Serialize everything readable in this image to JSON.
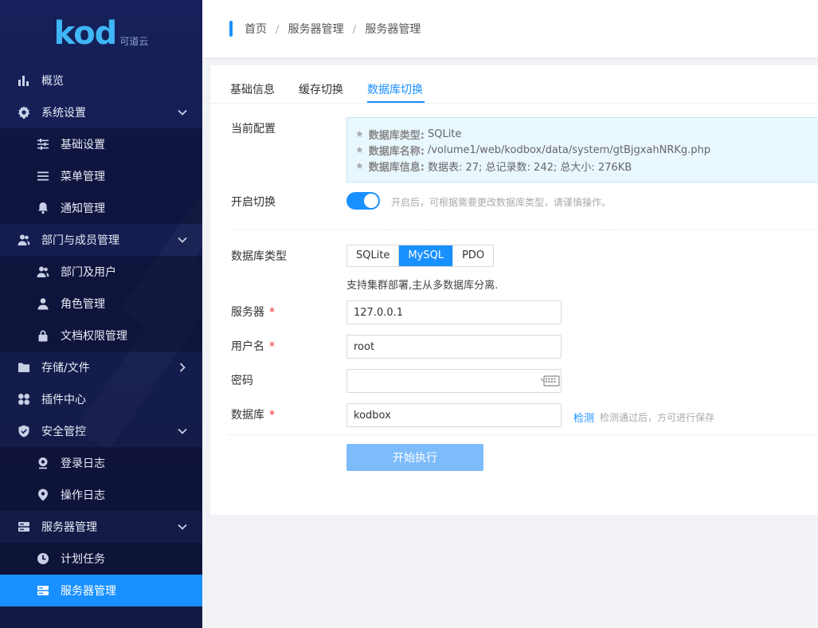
{
  "brand": {
    "logo_text": "kod",
    "logo_sub": "可道云"
  },
  "sidebar": {
    "items": [
      {
        "label": "概览"
      },
      {
        "label": "系统设置"
      },
      {
        "label": "基础设置"
      },
      {
        "label": "菜单管理"
      },
      {
        "label": "通知管理"
      },
      {
        "label": "部门与成员管理"
      },
      {
        "label": "部门及用户"
      },
      {
        "label": "角色管理"
      },
      {
        "label": "文档权限管理"
      },
      {
        "label": "存储/文件"
      },
      {
        "label": "插件中心"
      },
      {
        "label": "安全管控"
      },
      {
        "label": "登录日志"
      },
      {
        "label": "操作日志"
      },
      {
        "label": "服务器管理"
      },
      {
        "label": "计划任务"
      },
      {
        "label": "服务器管理"
      }
    ],
    "active_color": "#1890ff"
  },
  "breadcrumb": {
    "items": [
      "首页",
      "服务器管理",
      "服务器管理"
    ],
    "separator": "/"
  },
  "tabs": [
    {
      "label": "基础信息"
    },
    {
      "label": "缓存切换"
    },
    {
      "label": "数据库切换"
    }
  ],
  "form": {
    "current_config": {
      "label": "当前配置",
      "lines": [
        {
          "key": "数据库类型:",
          "value": "SQLite"
        },
        {
          "key": "数据库名称:",
          "value": "/volume1/web/kodbox/data/system/gtBjgxahNRKg.php"
        },
        {
          "key": "数据库信息:",
          "value": "数据表: 27; 总记录数: 242; 总大小: 276KB"
        }
      ]
    },
    "switch": {
      "label": "开启切换",
      "on": true,
      "hint": "开启后，可根据需要更改数据库类型，请谨慎操作。"
    },
    "db_type": {
      "label": "数据库类型",
      "options": [
        "SQLite",
        "MySQL",
        "PDO"
      ],
      "selected": "MySQL",
      "description": "支持集群部署,主从多数据库分离."
    },
    "server": {
      "label": "服务器",
      "required_mark": "*",
      "value": "127.0.0.1"
    },
    "username": {
      "label": "用户名",
      "required_mark": "*",
      "value": "root"
    },
    "password": {
      "label": "密码",
      "value": ""
    },
    "database": {
      "label": "数据库",
      "required_mark": "*",
      "value": "kodbox",
      "check_link": "检测",
      "check_hint": "检测通过后，方可进行保存"
    },
    "submit_label": "开始执行"
  }
}
